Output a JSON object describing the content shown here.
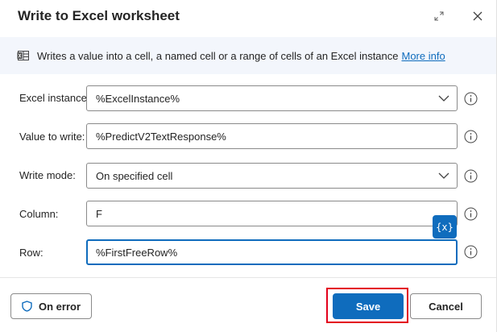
{
  "dialog": {
    "title": "Write to Excel worksheet",
    "expand_icon": "expand-diagonal-icon",
    "close_icon": "close-icon"
  },
  "info": {
    "icon": "excel-worksheet-icon",
    "description": "Writes a value into a cell, a named cell or a range of cells of an Excel instance",
    "link_text": "More info"
  },
  "fields": {
    "excel_instance": {
      "label": "Excel instance:",
      "value": "%ExcelInstance%"
    },
    "value_to_write": {
      "label": "Value to write:",
      "value": "%PredictV2TextResponse%"
    },
    "write_mode": {
      "label": "Write mode:",
      "value": "On specified cell"
    },
    "column": {
      "label": "Column:",
      "value": "F"
    },
    "row": {
      "label": "Row:",
      "value": "%FirstFreeRow%"
    }
  },
  "variable_button": {
    "label": "{x}"
  },
  "footer": {
    "on_error_label": "On error",
    "save_label": "Save",
    "cancel_label": "Cancel"
  },
  "colors": {
    "accent": "#0f6cbd",
    "highlight": "#e3001b",
    "info_bg": "#f3f6fc"
  }
}
